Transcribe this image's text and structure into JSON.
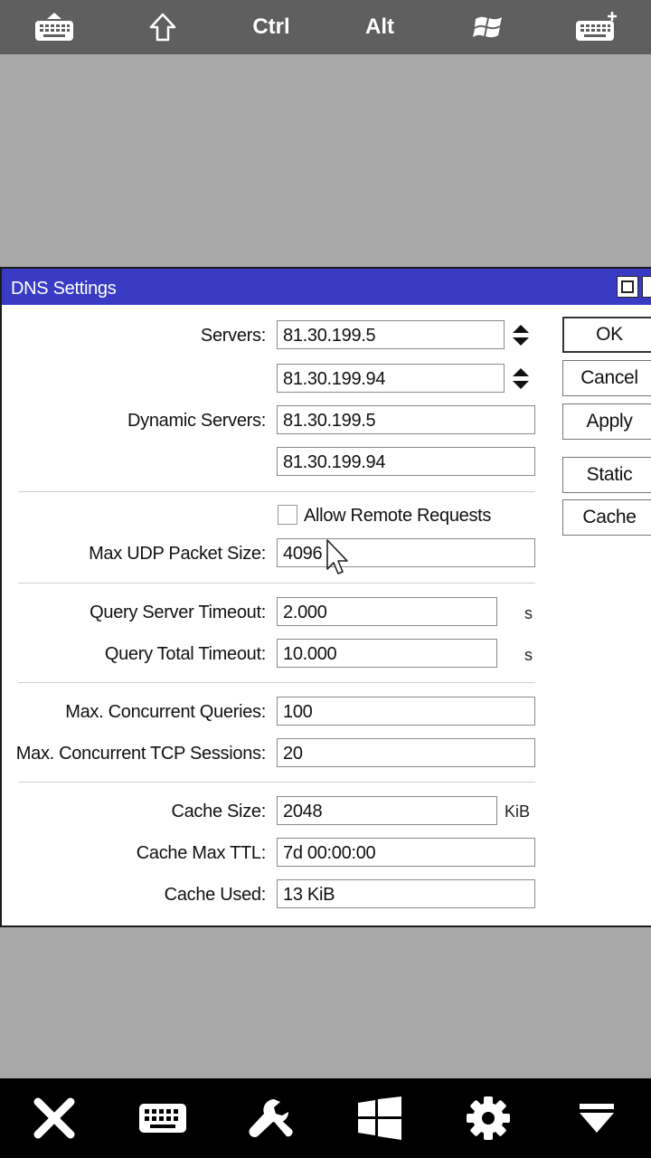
{
  "topbar": {
    "items": [
      {
        "icon": "keyboard-hide-icon"
      },
      {
        "icon": "shift-arrow-icon"
      },
      {
        "label": "Ctrl"
      },
      {
        "label": "Alt"
      },
      {
        "icon": "windows-logo-icon"
      },
      {
        "icon": "keyboard-add-icon"
      }
    ]
  },
  "dialog": {
    "title": "DNS Settings",
    "labels": {
      "servers": "Servers:",
      "dynamic_servers": "Dynamic Servers:",
      "max_udp": "Max UDP Packet Size:",
      "query_server_timeout": "Query Server Timeout:",
      "query_total_timeout": "Query Total Timeout:",
      "max_concurrent_queries": "Max. Concurrent Queries:",
      "max_concurrent_tcp": "Max. Concurrent TCP Sessions:",
      "cache_size": "Cache Size:",
      "cache_max_ttl": "Cache Max TTL:",
      "cache_used": "Cache Used:"
    },
    "values": {
      "servers": [
        "81.30.199.5",
        "81.30.199.94"
      ],
      "dynamic_servers": [
        "81.30.199.5",
        "81.30.199.94"
      ],
      "max_udp": "4096",
      "query_server_timeout": "2.000",
      "query_total_timeout": "10.000",
      "max_concurrent_queries": "100",
      "max_concurrent_tcp": "20",
      "cache_size": "2048",
      "cache_max_ttl": "7d 00:00:00",
      "cache_used": "13 KiB"
    },
    "units": {
      "seconds": "s",
      "kib": "KiB"
    },
    "allow_remote_requests": {
      "label": "Allow Remote Requests",
      "checked": false
    },
    "buttons": {
      "ok": "OK",
      "cancel": "Cancel",
      "apply": "Apply",
      "static": "Static",
      "cache": "Cache"
    }
  },
  "bottombar": {
    "items": [
      {
        "icon": "close-icon"
      },
      {
        "icon": "keyboard-icon"
      },
      {
        "icon": "wrench-icon"
      },
      {
        "icon": "windows-logo-icon"
      },
      {
        "icon": "gear-icon"
      },
      {
        "icon": "dropdown-arrow-icon"
      }
    ]
  },
  "colors": {
    "titlebar": "#3a3bc4",
    "desktop": "#a8a8a8",
    "topbar": "#5f5f5f",
    "bottombar": "#000000"
  }
}
